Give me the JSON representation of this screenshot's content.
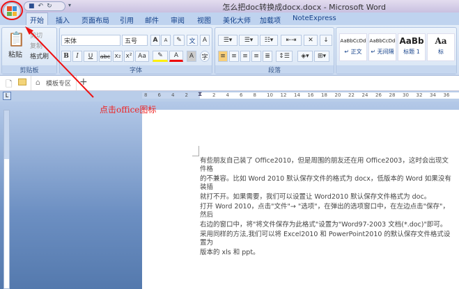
{
  "window": {
    "title": "怎么把doc转换成docx.docx - Microsoft Word"
  },
  "tabs": [
    "开始",
    "插入",
    "页面布局",
    "引用",
    "邮件",
    "审阅",
    "视图",
    "美化大师",
    "加载项",
    "NoteExpress"
  ],
  "clipboard": {
    "paste": "粘贴",
    "cut": "剪切",
    "copy": "复制",
    "format_painter": "格式刷",
    "label": "剪贴板"
  },
  "font": {
    "name": "宋体",
    "size": "五号",
    "label": "字体",
    "bold": "B",
    "italic": "I",
    "underline": "U",
    "strike": "abc",
    "sub": "x₂",
    "sup": "x²",
    "case": "Aa",
    "grow": "A",
    "shrink": "A",
    "color": "A",
    "charshade": "A"
  },
  "paragraph": {
    "label": "段落"
  },
  "styles": [
    {
      "sample": "AaBbCcDd",
      "name": "↵ 正文"
    },
    {
      "sample": "AaBbCcDd",
      "name": "↵ 无间隔"
    },
    {
      "sample": "AaBb",
      "name": "标题 1"
    },
    {
      "sample": "Aa",
      "name": "标"
    }
  ],
  "docbar": {
    "tab": "模板专区",
    "add": "+"
  },
  "ruler": {
    "left": [
      "8",
      "6",
      "4",
      "2"
    ],
    "right": [
      "2",
      "4",
      "6",
      "8",
      "10",
      "12",
      "14",
      "16",
      "18",
      "20",
      "22",
      "24",
      "26",
      "28",
      "30",
      "32",
      "34",
      "36"
    ]
  },
  "document": {
    "lines": [
      "有些朋友自己装了 Office2010，但是周围的朋友还在用 Office2003，这时会出现文件格",
      "的不兼容。比如 Word 2010 默认保存文件的格式为 docx，低版本的 Word 如果没有装插",
      "就打不开。如果需要，我们可以设置让 Word2010 默认保存文件格式为 doc。",
      "打开 Word 2010，点击\"文件\"→ \"选项\"，在弹出的选项窗口中，在左边点击\"保存\"，然后",
      "右边的窗口中，将\"将文件保存为此格式\"设置为\"Word97-2003 文档(*.doc)\"即可。",
      "采用同样的方法,我们可以将 Excel2010 和 PowerPoint2010 的默认保存文件格式设置为",
      "版本的 xls 和 ppt。"
    ]
  },
  "annotation": "点击office图标",
  "colors": {
    "annotation": "#ee2222",
    "ribbon": "#dbe7f5",
    "workspace": "#8fa9d2"
  }
}
